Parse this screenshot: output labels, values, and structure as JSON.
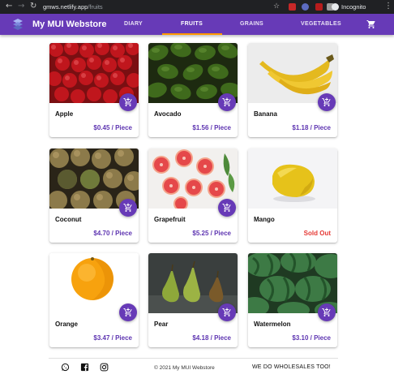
{
  "browser": {
    "url_host": "gmws.netlify.app",
    "url_path": "/fruits",
    "profile_label": "Incognito"
  },
  "app": {
    "brand": "My MUI Webstore",
    "tabs": [
      {
        "label": "DIARY",
        "active": false
      },
      {
        "label": "FRUITS",
        "active": true
      },
      {
        "label": "GRAINS",
        "active": false
      },
      {
        "label": "VEGETABLES",
        "active": false
      }
    ],
    "accent": "#673ab7",
    "indicator": "#ff9800"
  },
  "products": [
    {
      "name": "Apple",
      "price": "$0.45 / Piece",
      "icon": "apple-photo"
    },
    {
      "name": "Avocado",
      "price": "$1.56 / Piece",
      "icon": "avocado-photo"
    },
    {
      "name": "Banana",
      "price": "$1.18 / Piece",
      "icon": "banana-photo"
    },
    {
      "name": "Coconut",
      "price": "$4.70 / Piece",
      "icon": "coconut-photo"
    },
    {
      "name": "Grapefruit",
      "price": "$5.25 / Piece",
      "icon": "grapefruit-photo"
    },
    {
      "name": "Mango",
      "price": "Sold Out",
      "icon": "mango-photo",
      "sold_out": true
    },
    {
      "name": "Orange",
      "price": "$3.47 / Piece",
      "icon": "orange-photo"
    },
    {
      "name": "Pear",
      "price": "$4.18 / Piece",
      "icon": "pear-photo"
    },
    {
      "name": "Watermelon",
      "price": "$3.10 / Piece",
      "icon": "watermelon-photo"
    }
  ],
  "footer": {
    "copyright": "© 2021 My MUI Webstore",
    "wholesale": "WE DO WHOLESALES TOO!",
    "social": [
      "whatsapp-icon",
      "facebook-icon",
      "instagram-icon"
    ]
  }
}
